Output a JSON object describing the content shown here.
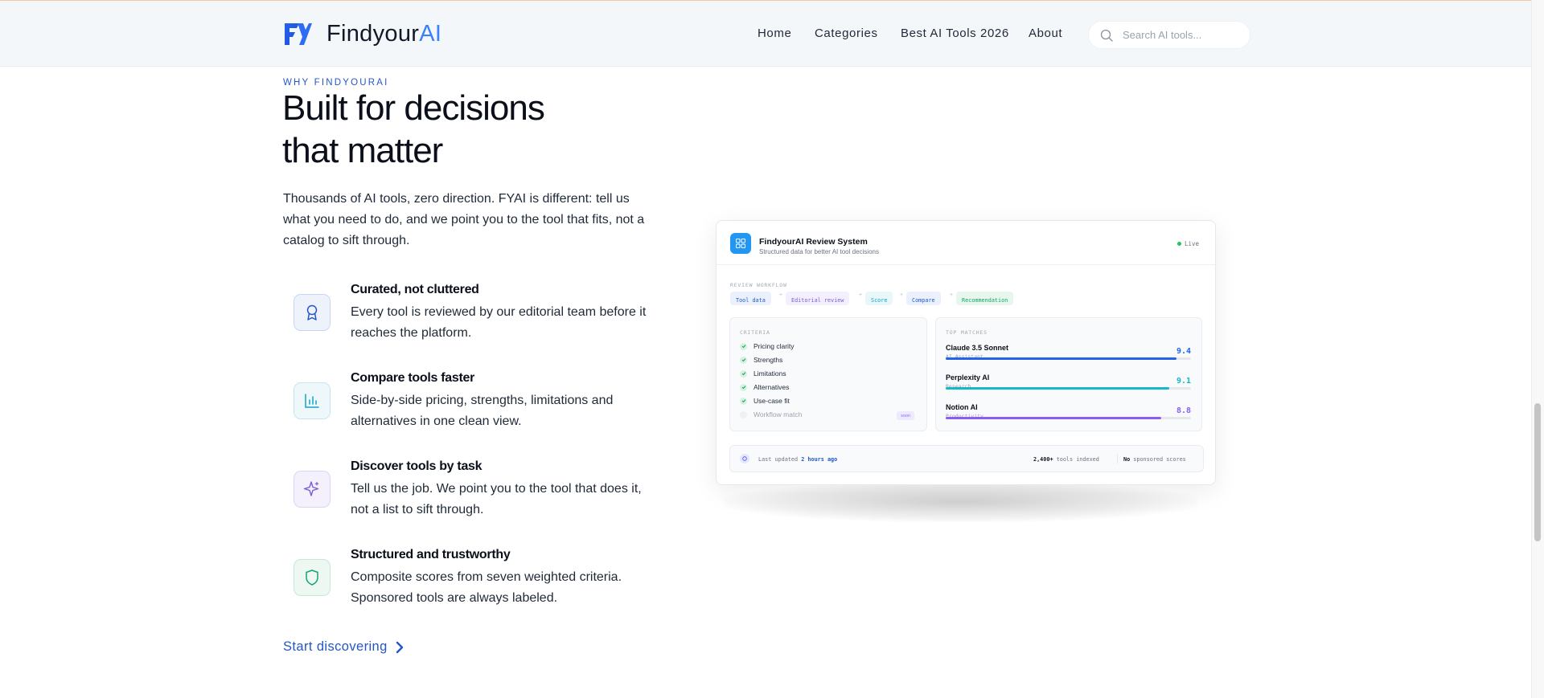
{
  "brand": {
    "name_main": "Findyour",
    "name_accent": "AI",
    "accent_color": "#3b82f6"
  },
  "nav": {
    "items": [
      "Home",
      "Categories",
      "Best AI Tools 2026",
      "About"
    ]
  },
  "search": {
    "placeholder": "Search AI tools..."
  },
  "section": {
    "eyebrow": "WHY FINDYOURAI",
    "heading_line1": "Built for decisions",
    "heading_line2": "that matter",
    "intro": "Thousands of AI tools, zero direction. FYAI is different: tell us what you need to do, and we point you to the tool that fits, not a catalog to sift through."
  },
  "features": [
    {
      "icon": "award-ribbon-icon",
      "title": "Curated, not cluttered",
      "desc": "Every tool is reviewed by our editorial team before it reaches the platform."
    },
    {
      "icon": "bar-chart-icon",
      "title": "Compare tools faster",
      "desc": "Side-by-side pricing, strengths, limitations and alternatives in one clean view."
    },
    {
      "icon": "sparkle-icon",
      "title": "Discover tools by task",
      "desc": "Tell us the job. We point you to the tool that does it, not a list to sift through."
    },
    {
      "icon": "shield-icon",
      "title": "Structured and trustworthy",
      "desc": "Composite scores from seven weighted criteria. Sponsored tools are always labeled."
    }
  ],
  "cta": {
    "label": "Start discovering"
  },
  "card": {
    "title": "FindyourAI Review System",
    "subtitle": "Structured data for better AI tool decisions",
    "status": "Live",
    "workflow_label": "REVIEW WORKFLOW",
    "workflow": [
      "Tool data",
      "Editorial review",
      "Score",
      "Compare",
      "Recommendation"
    ],
    "criteria_label": "CRITERIA",
    "criteria": [
      "Pricing clarity",
      "Strengths",
      "Limitations",
      "Alternatives",
      "Use-case fit",
      "Workflow match"
    ],
    "criteria_tag": "soon",
    "matches_label": "TOP MATCHES",
    "matches": [
      {
        "name": "Claude 3.5 Sonnet",
        "category": "AI Assistant",
        "score": "9.4",
        "level": 0.94,
        "color": "#2563eb"
      },
      {
        "name": "Perplexity AI",
        "category": "Research",
        "score": "9.1",
        "level": 0.91,
        "color": "#14b8c9"
      },
      {
        "name": "Notion AI",
        "category": "Productivity",
        "score": "8.8",
        "level": 0.88,
        "color": "#8b5cf6"
      }
    ],
    "footer": {
      "updated_prefix": "Last updated",
      "updated_value": "2 hours ago",
      "indexed_count": "2,400+",
      "indexed_label": "tools indexed",
      "sponsored_no": "No",
      "sponsored_label": "sponsored scores"
    }
  }
}
